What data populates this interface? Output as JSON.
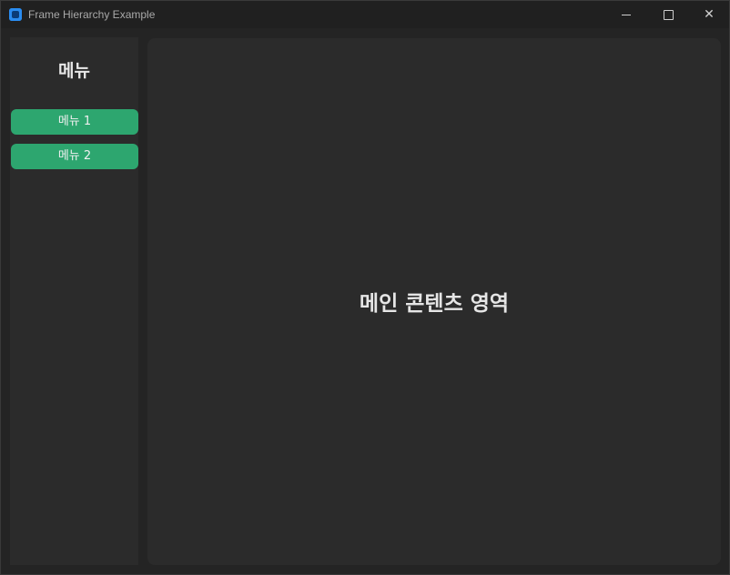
{
  "window": {
    "title": "Frame Hierarchy Example",
    "app_icon": "app-icon",
    "controls": {
      "minimize": "minimize-icon",
      "maximize": "maximize-icon",
      "close": "close-icon",
      "close_glyph": "✕"
    }
  },
  "sidebar": {
    "title": "메뉴",
    "items": [
      {
        "label": "메뉴 1"
      },
      {
        "label": "메뉴 2"
      }
    ]
  },
  "main": {
    "title": "메인 콘텐츠 영역"
  },
  "colors": {
    "window_bg": "#242424",
    "panel_bg": "#2b2b2b",
    "accent_button": "#2da66f",
    "titlebar_bg": "#202020"
  }
}
